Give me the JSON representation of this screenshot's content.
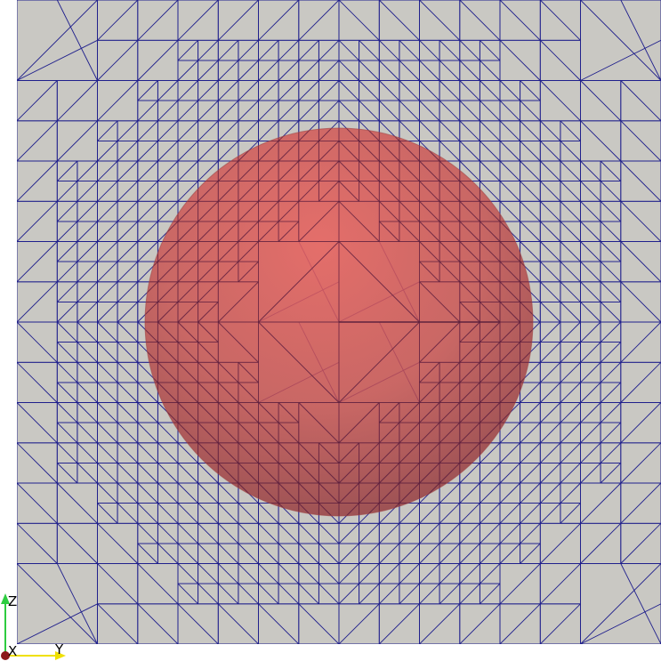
{
  "viewer": {
    "background_color": "#ffffff",
    "mesh": {
      "face_color": "#c9c8c3",
      "edge_color": "#1f1f8c",
      "representation": "surface-with-edges"
    },
    "sphere": {
      "color": "#d85a56",
      "opacity_note": "translucent"
    },
    "orientation_axes": {
      "labels": {
        "z": "Z",
        "x": "X",
        "y": "Y"
      },
      "colors": {
        "z": "#2ecc40",
        "y": "#f0e000",
        "x": "#8b1a1a"
      }
    }
  }
}
